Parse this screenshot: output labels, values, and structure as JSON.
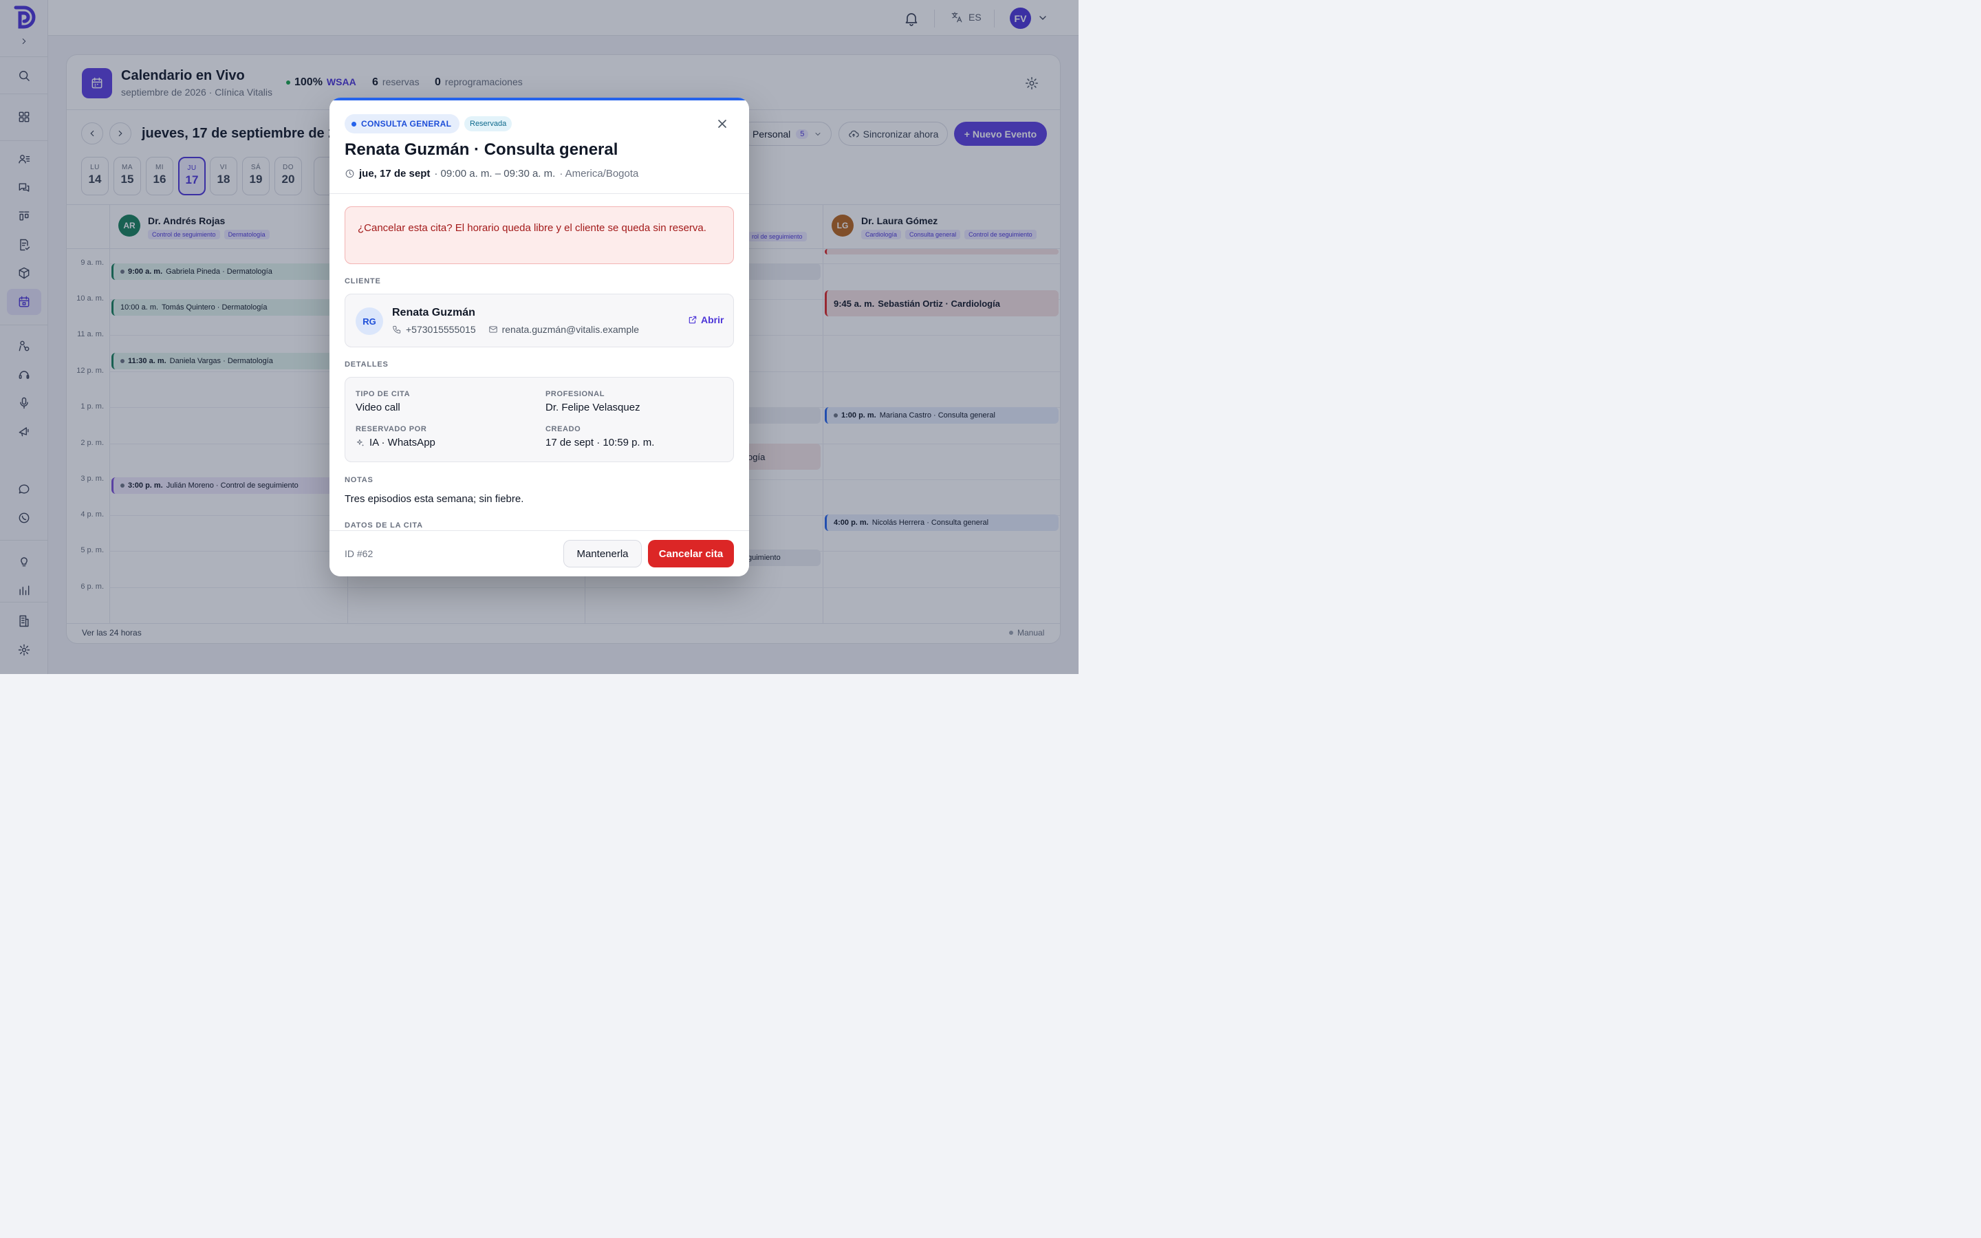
{
  "topbar": {
    "language": "ES",
    "user_initials": "FV"
  },
  "calendar": {
    "title": "Calendario en Vivo",
    "subtitle": "septiembre de 2026 · Clínica Vitalis",
    "stat_pct": "100%",
    "stat_pct_label": "WSAA",
    "stat_bookings": "6",
    "stat_bookings_label": "reservas",
    "stat_resched": "0",
    "stat_resched_label": "reprogramaciones",
    "date_title": "jueves, 17 de septiembre de 2026",
    "days": [
      {
        "name": "LU",
        "num": "14"
      },
      {
        "name": "MA",
        "num": "15"
      },
      {
        "name": "MI",
        "num": "16"
      },
      {
        "name": "JU",
        "num": "17"
      },
      {
        "name": "VI",
        "num": "18"
      },
      {
        "name": "SÁ",
        "num": "19"
      },
      {
        "name": "DO",
        "num": "20"
      }
    ],
    "filter_label": "Personal",
    "filter_count": "5",
    "sync_label": "Sincronizar ahora",
    "new_event_label": "+ Nuevo Evento",
    "hours": [
      "9 a. m.",
      "10 a. m.",
      "11 a. m.",
      "12 p. m.",
      "1 p. m.",
      "2 p. m.",
      "3 p. m.",
      "4 p. m.",
      "5 p. m.",
      "6 p. m."
    ],
    "resources": [
      {
        "initials": "AR",
        "name": "Dr. Andrés Rojas",
        "tags": [
          "Control de seguimiento",
          "Dermatología"
        ],
        "color": "#16805a"
      },
      {
        "initials": "LG",
        "name": "Dr. Laura Gómez",
        "tags": [
          "Cardiología",
          "Consulta general",
          "Control de seguimiento"
        ],
        "color": "#b8651b"
      }
    ],
    "partial_tag": "rol de seguimiento",
    "events": [
      {
        "time": "9:00 a. m.",
        "text": "Gabriela Pineda · Dermatología"
      },
      {
        "time": "10:00 a. m.",
        "text": "Tomás Quintero · Dermatología"
      },
      {
        "time": "11:30 a. m.",
        "text": "Daniela Vargas · Dermatología"
      },
      {
        "time": "3:00 p. m.",
        "text": "Julián Moreno · Control de seguimiento"
      },
      {
        "time": "9:45 a. m.",
        "text": "Sebastián Ortiz · Cardiología"
      },
      {
        "time": "1:00 p. m.",
        "text": "Mariana Castro · Consulta general"
      },
      {
        "time": "4:00 p. m.",
        "text": "Nicolás Herrera · Consulta general"
      }
    ],
    "partial_events": [
      "ral",
      "ogía",
      "guimiento"
    ],
    "footer_left": "Ver las 24 horas",
    "footer_right": "Manual"
  },
  "modal": {
    "type_chip": "CONSULTA GENERAL",
    "status_badge": "Reservada",
    "title": "Renata Guzmán · Consulta general",
    "date": "jue, 17 de sept",
    "time_range": "· 09:00 a. m. – 09:30 a. m.",
    "timezone": "· America/Bogota",
    "alert": "¿Cancelar esta cita? El horario queda libre y el cliente se queda sin reserva.",
    "client_section": "CLIENTE",
    "client": {
      "initials": "RG",
      "name": "Renata Guzmán",
      "phone": "+573015555015",
      "email": "renata.guzmán@vitalis.example",
      "open_label": "Abrir"
    },
    "details_section": "DETALLES",
    "details": {
      "type_label": "TIPO DE CITA",
      "type_value": "Video call",
      "pro_label": "PROFESIONAL",
      "pro_value": "Dr. Felipe Velasquez",
      "booked_label": "RESERVADO POR",
      "booked_value": "IA · WhatsApp",
      "created_label": "CREADO",
      "created_value": "17 de sept · 10:59 p. m."
    },
    "notes_section": "NOTAS",
    "notes": "Tres episodios esta semana; sin fiebre.",
    "data_section": "DATOS DE LA CITA",
    "id": "ID #62",
    "keep_label": "Mantenerla",
    "cancel_label": "Cancelar cita"
  }
}
